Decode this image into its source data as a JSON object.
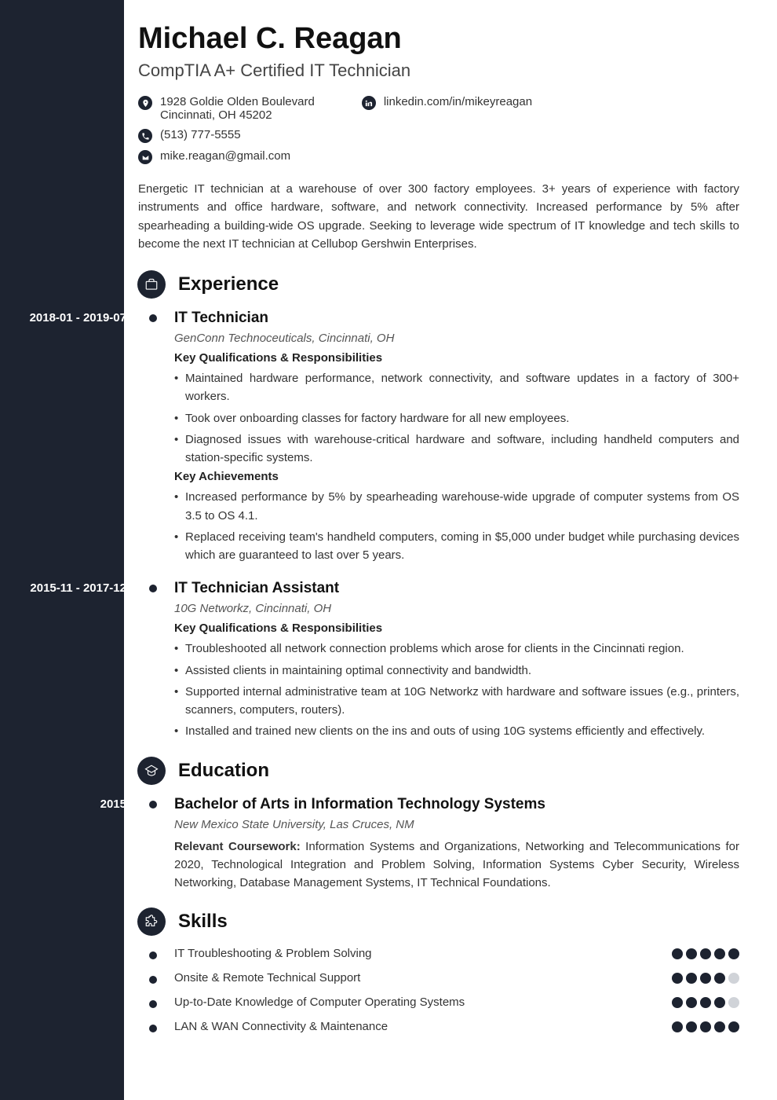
{
  "name": "Michael C. Reagan",
  "subtitle": "CompTIA A+ Certified IT Technician",
  "contacts": {
    "address_line1": "1928 Goldie Olden Boulevard",
    "address_line2": "Cincinnati, OH 45202",
    "phone": "(513) 777-5555",
    "email": "mike.reagan@gmail.com",
    "linkedin": "linkedin.com/in/mikeyreagan"
  },
  "summary": "Energetic IT technician at a warehouse of over 300 factory employees. 3+ years of experience with factory instruments and office hardware, software, and network connectivity. Increased performance by 5% after spearheading a building-wide OS upgrade. Seeking to leverage wide spectrum of IT knowledge and tech skills to become the next IT technician at Cellubop Gershwin Enterprises.",
  "sections": {
    "experience_title": "Experience",
    "education_title": "Education",
    "skills_title": "Skills"
  },
  "experience": [
    {
      "dates": "2018-01 - 2019-07",
      "title": "IT Technician",
      "company": "GenConn Technoceuticals, Cincinnati, OH",
      "resp_header": "Key Qualifications & Responsibilities",
      "responsibilities": [
        "Maintained hardware performance, network connectivity, and software updates in a factory of 300+ workers.",
        "Took over onboarding classes for factory hardware for all new employees.",
        "Diagnosed issues with warehouse-critical hardware and software, including handheld computers and station-specific systems."
      ],
      "ach_header": "Key Achievements",
      "achievements": [
        "Increased performance by 5% by spearheading warehouse-wide upgrade of computer systems from OS 3.5 to OS 4.1.",
        "Replaced receiving team's handheld computers, coming in $5,000 under budget while purchasing devices which are guaranteed to last over 5 years."
      ]
    },
    {
      "dates": "2015-11 - 2017-12",
      "title": "IT Technician Assistant",
      "company": "10G Networkz, Cincinnati, OH",
      "resp_header": "Key Qualifications & Responsibilities",
      "responsibilities": [
        "Troubleshooted all network connection problems which arose for clients in the Cincinnati region.",
        "Assisted clients in maintaining optimal connectivity and bandwidth.",
        "Supported internal administrative team at 10G Networkz with hardware and software issues (e.g., printers, scanners, computers, routers).",
        "Installed and trained new clients on the ins and outs of using 10G systems efficiently and effectively."
      ]
    }
  ],
  "education": [
    {
      "dates": "2015",
      "title": "Bachelor of Arts in Information Technology Systems",
      "school": "New Mexico State University, Las Cruces, NM",
      "coursework_label": "Relevant Coursework:",
      "coursework": " Information Systems and Organizations, Networking and Telecommunications for 2020, Technological Integration and Problem Solving, Information Systems Cyber Security, Wireless Networking, Database Management Systems, IT Technical Foundations."
    }
  ],
  "skills": [
    {
      "name": "IT Troubleshooting & Problem Solving",
      "rating": 5
    },
    {
      "name": "Onsite & Remote Technical Support",
      "rating": 4
    },
    {
      "name": "Up-to-Date Knowledge of Computer Operating Systems",
      "rating": 4
    },
    {
      "name": "LAN & WAN Connectivity & Maintenance",
      "rating": 5
    }
  ]
}
